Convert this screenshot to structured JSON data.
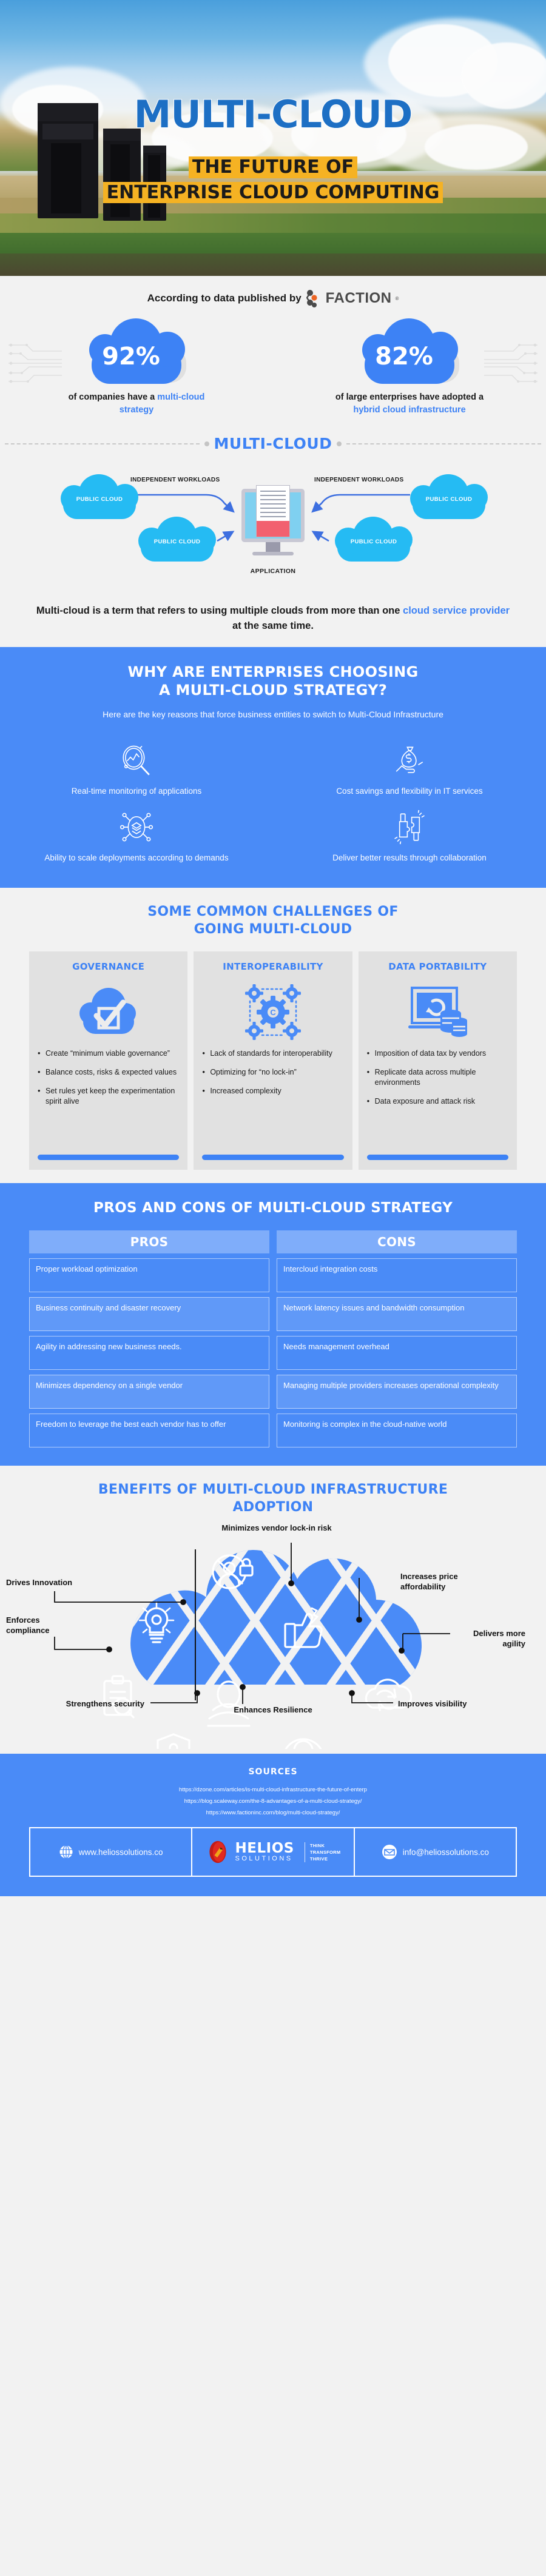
{
  "hero": {
    "title": "MULTI-CLOUD",
    "subtitle_line1": "THE FUTURE OF",
    "subtitle_line2": "ENTERPRISE CLOUD COMPUTING"
  },
  "stats": {
    "heading": "According to data published by",
    "brand": "FACTION",
    "brand_reg": "®",
    "items": [
      {
        "value": "92%",
        "caption_plain": "of companies have a ",
        "caption_accent": "multi-cloud strategy"
      },
      {
        "value": "82%",
        "caption_plain": "of large enterprises have adopted a ",
        "caption_accent": "hybrid cloud infrastructure"
      }
    ]
  },
  "multicloud": {
    "title": "MULTI-CLOUD",
    "cloud_label": "PUBLIC CLOUD",
    "workload_label": "INDEPENDENT WORKLOADS",
    "app_label": "APPLICATION",
    "description_part1": "Multi-cloud is a term that refers to using multiple clouds from more than one ",
    "description_accent": "cloud service provider",
    "description_part2": " at the same time."
  },
  "why": {
    "title_line1": "WHY ARE ENTERPRISES CHOOSING",
    "title_line2": "A MULTI-CLOUD STRATEGY?",
    "subtitle": "Here are the key reasons that force business entities to switch to Multi-Cloud Infrastructure",
    "items": [
      {
        "icon": "magnifier-chart-icon",
        "label": "Real-time monitoring of applications"
      },
      {
        "icon": "money-bag-hand-icon",
        "label": "Cost savings and flexibility in IT services"
      },
      {
        "icon": "scale-network-icon",
        "label": "Ability to scale deployments according to demands"
      },
      {
        "icon": "puzzle-handshake-icon",
        "label": "Deliver better results through collaboration"
      }
    ]
  },
  "challenges": {
    "title_line1": "SOME COMMON CHALLENGES OF",
    "title_line2": "GOING MULTI-CLOUD",
    "cards": [
      {
        "title": "GOVERNANCE",
        "icon": "cloud-checkmark-icon",
        "bullets": [
          "Create “minimum viable governance”",
          "Balance costs, risks & expected values",
          "Set rules yet keep the experimentation spirit alive"
        ]
      },
      {
        "title": "INTEROPERABILITY",
        "icon": "gears-network-icon",
        "bullets": [
          "Lack of standards for interoperability",
          "Optimizing for “no lock-in”",
          "Increased complexity"
        ]
      },
      {
        "title": "DATA PORTABILITY",
        "icon": "database-transfer-icon",
        "bullets": [
          "Imposition of data tax by vendors",
          "Replicate data across multiple environments",
          "Data exposure and attack risk"
        ]
      }
    ]
  },
  "proscons": {
    "title": "PROS AND CONS OF MULTI-CLOUD STRATEGY",
    "pros_header": "PROS",
    "cons_header": "CONS",
    "pros": [
      "Proper workload optimization",
      "Business continuity and disaster recovery",
      "Agility in addressing new business needs.",
      "Minimizes dependency on a single vendor",
      "Freedom to leverage the best each vendor has to offer"
    ],
    "cons": [
      "Intercloud integration costs",
      "Network latency issues and bandwidth consumption",
      "Needs management overhead",
      "Managing multiple providers increases operational complexity",
      "Monitoring is complex in the cloud-native world"
    ]
  },
  "benefits": {
    "title_line1": "BENEFITS OF MULTI-CLOUD INFRASTRUCTURE",
    "title_line2": "ADOPTION",
    "labels": [
      {
        "text": "Minimizes vendor lock-in risk",
        "icon": "no-lock-user-icon"
      },
      {
        "text": "Drives Innovation",
        "icon": "lightbulb-gear-icon"
      },
      {
        "text": "Increases price affordability",
        "icon": "thumbs-up-money-icon"
      },
      {
        "text": "Enforces compliance",
        "icon": "clipboard-check-icon"
      },
      {
        "text": "Delivers more agility",
        "icon": "cloud-sync-icon"
      },
      {
        "text": "Strengthens security",
        "icon": "shield-lock-icon"
      },
      {
        "text": "Enhances Resilience",
        "icon": "resilience-wave-icon"
      },
      {
        "text": "Improves visibility",
        "icon": "eye-visibility-icon"
      }
    ]
  },
  "sources": {
    "title": "SOURCES",
    "urls": [
      "https://dzone.com/articles/is-multi-cloud-infrastructure-the-future-of-enterp",
      "https://blog.scaleway.com/the-8-advantages-of-a-multi-cloud-strategy/",
      "https://www.factioninc.com/blog/multi-cloud-strategy/"
    ]
  },
  "footer": {
    "website": "www.heliossolutions.co",
    "brand_main": "HELIOS",
    "brand_sub": "SOLUTIONS",
    "tagline_line1": "THINK",
    "tagline_line2": "TRANSFORM",
    "tagline_line3": "THRIVE",
    "email": "info@heliossolutions.co"
  },
  "colors": {
    "primary_blue": "#3d82f5",
    "section_blue": "#4a8bf7",
    "header_yellow": "#f5b223",
    "title_blue": "#1d6fc4",
    "light_grey": "#e1e1e1",
    "page_bg": "#f2f2f2"
  }
}
